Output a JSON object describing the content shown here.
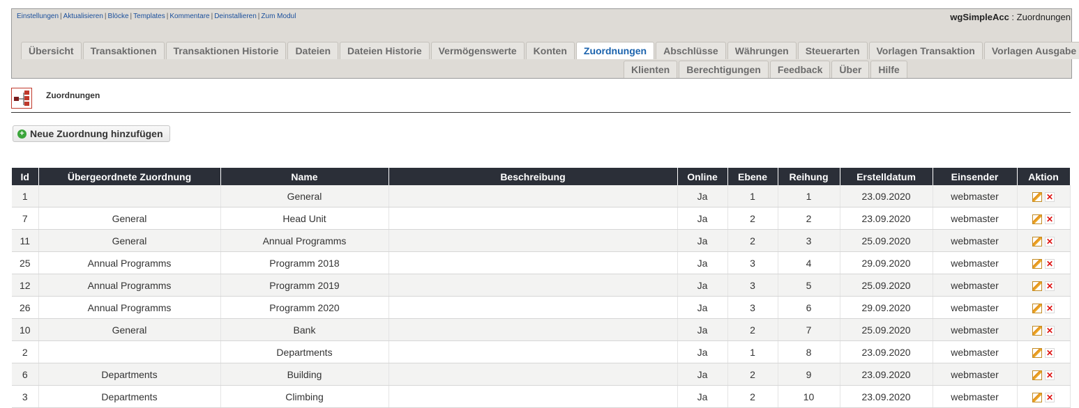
{
  "admin_links": [
    "Einstellungen",
    "Aktualisieren",
    "Blöcke",
    "Templates",
    "Kommentare",
    "Deinstallieren",
    "Zum Modul"
  ],
  "module_title": {
    "name": "wgSimpleAcc",
    "page": " : Zuordnungen"
  },
  "tabs_row1": [
    "Übersicht",
    "Transaktionen",
    "Transaktionen Historie",
    "Dateien",
    "Dateien Historie",
    "Vermögenswerte",
    "Konten",
    "Zuordnungen",
    "Abschlüsse",
    "Währungen",
    "Steuerarten",
    "Vorlagen Transaktion",
    "Vorlagen Ausgabe"
  ],
  "tabs_row2": [
    "Klienten",
    "Berechtigungen",
    "Feedback",
    "Über",
    "Hilfe"
  ],
  "active_tab": "Zuordnungen",
  "page_heading": "Zuordnungen",
  "add_button": "Neue Zuordnung hinzufügen",
  "table": {
    "headers": [
      "Id",
      "Übergeordnete Zuordnung",
      "Name",
      "Beschreibung",
      "Online",
      "Ebene",
      "Reihung",
      "Erstelldatum",
      "Einsender",
      "Aktion"
    ],
    "rows": [
      [
        "1",
        "",
        "General",
        "",
        "Ja",
        "1",
        "1",
        "23.09.2020",
        "webmaster"
      ],
      [
        "7",
        "General",
        "Head Unit",
        "",
        "Ja",
        "2",
        "2",
        "23.09.2020",
        "webmaster"
      ],
      [
        "11",
        "General",
        "Annual Programms",
        "",
        "Ja",
        "2",
        "3",
        "25.09.2020",
        "webmaster"
      ],
      [
        "25",
        "Annual Programms",
        "Programm 2018",
        "",
        "Ja",
        "3",
        "4",
        "29.09.2020",
        "webmaster"
      ],
      [
        "12",
        "Annual Programms",
        "Programm 2019",
        "",
        "Ja",
        "3",
        "5",
        "25.09.2020",
        "webmaster"
      ],
      [
        "26",
        "Annual Programms",
        "Programm 2020",
        "",
        "Ja",
        "3",
        "6",
        "29.09.2020",
        "webmaster"
      ],
      [
        "10",
        "General",
        "Bank",
        "",
        "Ja",
        "2",
        "7",
        "25.09.2020",
        "webmaster"
      ],
      [
        "2",
        "",
        "Departments",
        "",
        "Ja",
        "1",
        "8",
        "23.09.2020",
        "webmaster"
      ],
      [
        "6",
        "Departments",
        "Building",
        "",
        "Ja",
        "2",
        "9",
        "23.09.2020",
        "webmaster"
      ],
      [
        "3",
        "Departments",
        "Climbing",
        "",
        "Ja",
        "2",
        "10",
        "23.09.2020",
        "webmaster"
      ]
    ]
  },
  "icons": {
    "edit": "edit-icon",
    "delete": "delete-icon",
    "add": "add-circle-icon",
    "heading": "hierarchy-icon"
  },
  "colors": {
    "header_bg": "#dedbd6",
    "table_header": "#2b2f38",
    "active_tab_text": "#1b63ad",
    "link": "#1a4f9c"
  }
}
